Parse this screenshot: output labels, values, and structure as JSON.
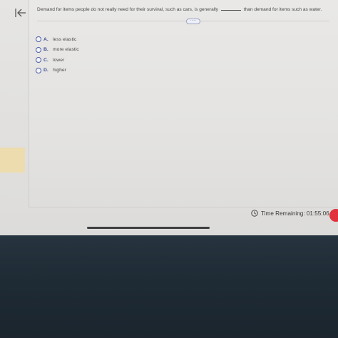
{
  "question": {
    "text_before": "Demand for items people do not really need for their survival, such as cars, is generally",
    "text_after": "than demand for items such as water."
  },
  "more_label": "·····",
  "options": [
    {
      "letter": "A.",
      "text": "less elastic"
    },
    {
      "letter": "B.",
      "text": "more elastic"
    },
    {
      "letter": "C.",
      "text": "lower"
    },
    {
      "letter": "D.",
      "text": "higher"
    }
  ],
  "timer": {
    "label": "Time Remaining:",
    "value": "01:55:06"
  },
  "icons": {
    "collapse": "collapse-panel-icon",
    "clock": "clock-icon"
  },
  "colors": {
    "accent": "#3f4f91",
    "alert": "#e1323d"
  }
}
